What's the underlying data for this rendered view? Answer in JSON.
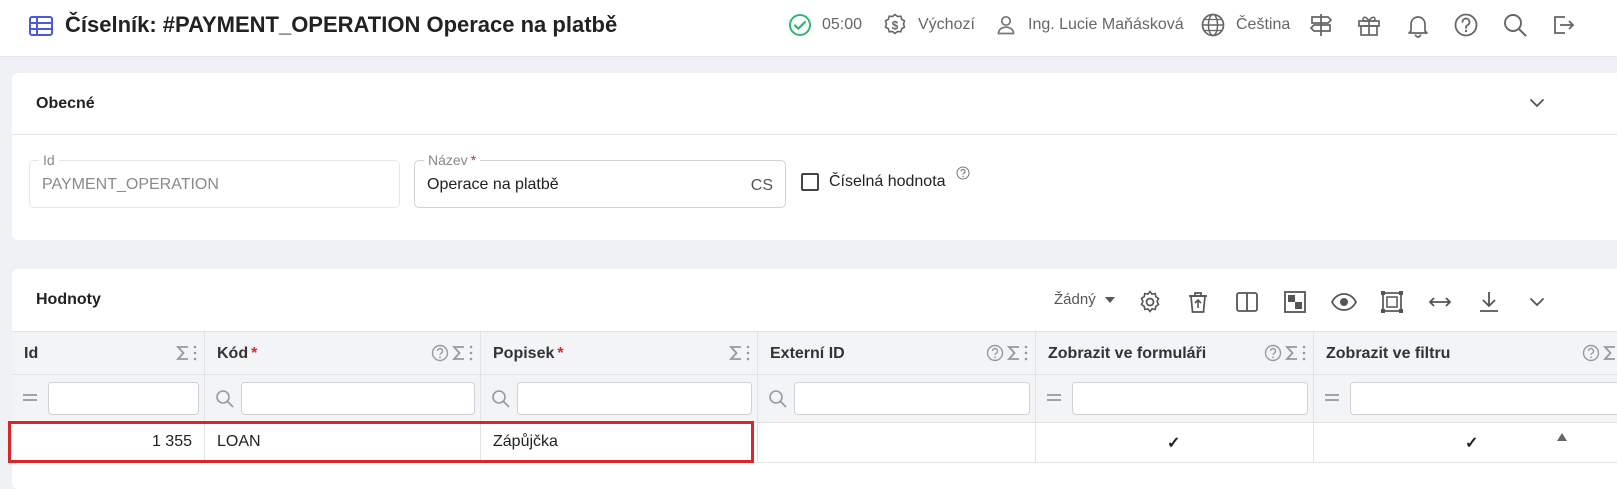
{
  "header": {
    "title": "Číselník: #PAYMENT_OPERATION Operace na platbě",
    "title_icon": "table-icon",
    "time": "05:00",
    "currency": "Výchozí",
    "user": "Ing. Lucie Maňásková",
    "language": "Čeština",
    "icons": [
      "check-circle-icon",
      "currency-icon",
      "user-icon",
      "globe-icon",
      "signpost-icon",
      "gift-icon",
      "bell-icon",
      "help-icon",
      "search-icon",
      "logout-icon"
    ],
    "status_color": "#2eb872"
  },
  "general": {
    "title": "Obecné",
    "id_field": {
      "label": "Id",
      "value": "PAYMENT_OPERATION"
    },
    "name_field": {
      "label": "Název",
      "required_mark": "*",
      "value": "Operace na platbě",
      "lang": "CS"
    },
    "numeric_checkbox": {
      "label": "Číselná hodnota",
      "checked": false
    }
  },
  "values": {
    "title": "Hodnoty",
    "grouping_select": "Žádný",
    "toolbar_icons": [
      "settings-icon",
      "delete-icon",
      "columns-icon",
      "layout-icon",
      "eye-icon",
      "frame-icon",
      "resize-icon",
      "download-icon",
      "chevron-down-icon"
    ],
    "columns": [
      {
        "label": "Id",
        "required": false,
        "help": false
      },
      {
        "label": "Kód",
        "required": true,
        "help": true
      },
      {
        "label": "Popisek",
        "required": true,
        "help": false
      },
      {
        "label": "Externí ID",
        "required": false,
        "help": true
      },
      {
        "label": "Zobrazit ve formuláři",
        "required": false,
        "help": true
      },
      {
        "label": "Zobrazit ve filtru",
        "required": false,
        "help": true
      }
    ],
    "required_mark": "*",
    "rows": [
      {
        "id": "1 355",
        "code": "LOAN",
        "label": "Zápůjčka",
        "external_id": "",
        "show_in_form": true,
        "show_in_filter": true
      }
    ],
    "check_glyph": "✓",
    "highlight_color": "#d9262b"
  }
}
